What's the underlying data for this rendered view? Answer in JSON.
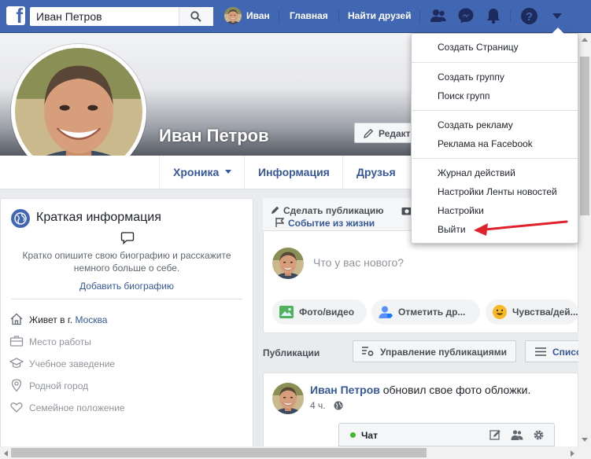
{
  "topbar": {
    "logo": "f",
    "search_value": "Иван Петров",
    "user_name": "Иван",
    "home": "Главная",
    "find_friends": "Найти друзей",
    "icons": [
      "friend-requests-icon",
      "messenger-icon",
      "notifications-icon",
      "help-icon",
      "account-menu-chevron-icon"
    ]
  },
  "profile": {
    "name": "Иван Петров",
    "edit_label": "Редакт"
  },
  "tabs": [
    "Хроника",
    "Информация",
    "Друзья"
  ],
  "intro": {
    "title": "Краткая информация",
    "text": "Кратко опишите свою биографию и расскажите немного больше о себе.",
    "add_bio": "Добавить биографию",
    "lives_prefix": "Живет в г.",
    "lives_city": "Москва",
    "workplace": "Место работы",
    "education": "Учебное заведение",
    "hometown": "Родной город",
    "relationship": "Семейное положение"
  },
  "composer": {
    "make_post": "Сделать публикацию",
    "life_event": "Событие из жизни",
    "placeholder": "Что у вас нового?",
    "photo_video": "Фото/видео",
    "tag_friends": "Отметить др...",
    "feelings": "Чувства/дей..."
  },
  "posts": {
    "label": "Публикации",
    "manage": "Управление публикациями",
    "list": "Списо"
  },
  "post": {
    "author": "Иван Петров",
    "action": " обновил свое фото обложки.",
    "time": "4 ч."
  },
  "chat": {
    "label": "Чат"
  },
  "menu": {
    "items": [
      "Создать Страницу",
      "Создать группу",
      "Поиск групп",
      "Создать рекламу",
      "Реклама на Facebook",
      "Журнал действий",
      "Настройки Ленты новостей",
      "Настройки",
      "Выйти"
    ]
  },
  "colors": {
    "brand": "#4267b2",
    "link": "#365899",
    "arrow": "#e0202a"
  }
}
